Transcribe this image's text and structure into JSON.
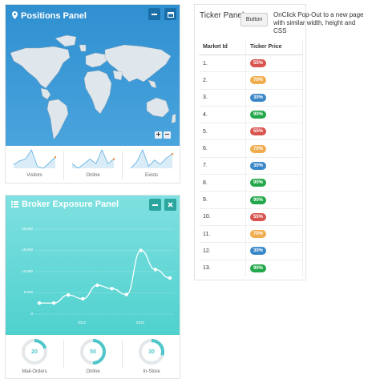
{
  "positions_panel": {
    "title": "Positions Panel",
    "sparklines": [
      {
        "label": "Visitors",
        "values": [
          6,
          8,
          9,
          14,
          5,
          4,
          7,
          10
        ]
      },
      {
        "label": "Online",
        "values": [
          9,
          8,
          9,
          10,
          9,
          12,
          9,
          10
        ]
      },
      {
        "label": "Exists",
        "values": [
          5,
          8,
          14,
          6,
          9,
          7,
          10,
          12
        ]
      }
    ]
  },
  "broker_panel": {
    "title": "Broker Exposure Panel",
    "chart_data": {
      "type": "line",
      "yticks": [
        "20,000",
        "15,000",
        "10,000",
        "5,000",
        "0"
      ],
      "xticks": [
        "2012",
        "2013"
      ],
      "ylim": [
        0,
        20000
      ],
      "values": [
        2600,
        2600,
        4500,
        3600,
        6800,
        6000,
        4600,
        15000,
        10500,
        8500
      ]
    },
    "donuts": [
      {
        "label": "Mail-Orders",
        "value": "20",
        "fraction": 0.2
      },
      {
        "label": "Online",
        "value": "50",
        "fraction": 0.5
      },
      {
        "label": "In-Store",
        "value": "30",
        "fraction": 0.3
      }
    ]
  },
  "ticker_panel": {
    "title": "Ticker Panel",
    "button_label": "Button",
    "columns": [
      "Market Id",
      "Ticker Price"
    ],
    "rows": [
      {
        "id": "1.",
        "price": "55%",
        "color": "#d9534f"
      },
      {
        "id": "2.",
        "price": "70%",
        "color": "#f0ad4e"
      },
      {
        "id": "3.",
        "price": "30%",
        "color": "#3a87c8"
      },
      {
        "id": "4.",
        "price": "90%",
        "color": "#22a84a"
      },
      {
        "id": "5.",
        "price": "55%",
        "color": "#d9534f"
      },
      {
        "id": "6.",
        "price": "70%",
        "color": "#f0ad4e"
      },
      {
        "id": "7.",
        "price": "30%",
        "color": "#3a87c8"
      },
      {
        "id": "8.",
        "price": "90%",
        "color": "#22a84a"
      },
      {
        "id": "9.",
        "price": "90%",
        "color": "#22a84a"
      },
      {
        "id": "10.",
        "price": "55%",
        "color": "#d9534f"
      },
      {
        "id": "11.",
        "price": "70%",
        "color": "#f0ad4e"
      },
      {
        "id": "12.",
        "price": "30%",
        "color": "#3a87c8"
      },
      {
        "id": "13.",
        "price": "90%",
        "color": "#22a84a"
      }
    ]
  },
  "note": "OnClick Pop-Out to a new page with similar width, height and CSS",
  "icons": {
    "positions_title": "map-marker-icon",
    "positions_btn_1": "minus-icon",
    "positions_btn_2": "calendar-icon",
    "broker_title": "grid-icon",
    "broker_btn_1": "minus-icon",
    "broker_btn_2": "close-icon",
    "zoom_in": "plus-icon",
    "zoom_out": "minus-icon"
  }
}
